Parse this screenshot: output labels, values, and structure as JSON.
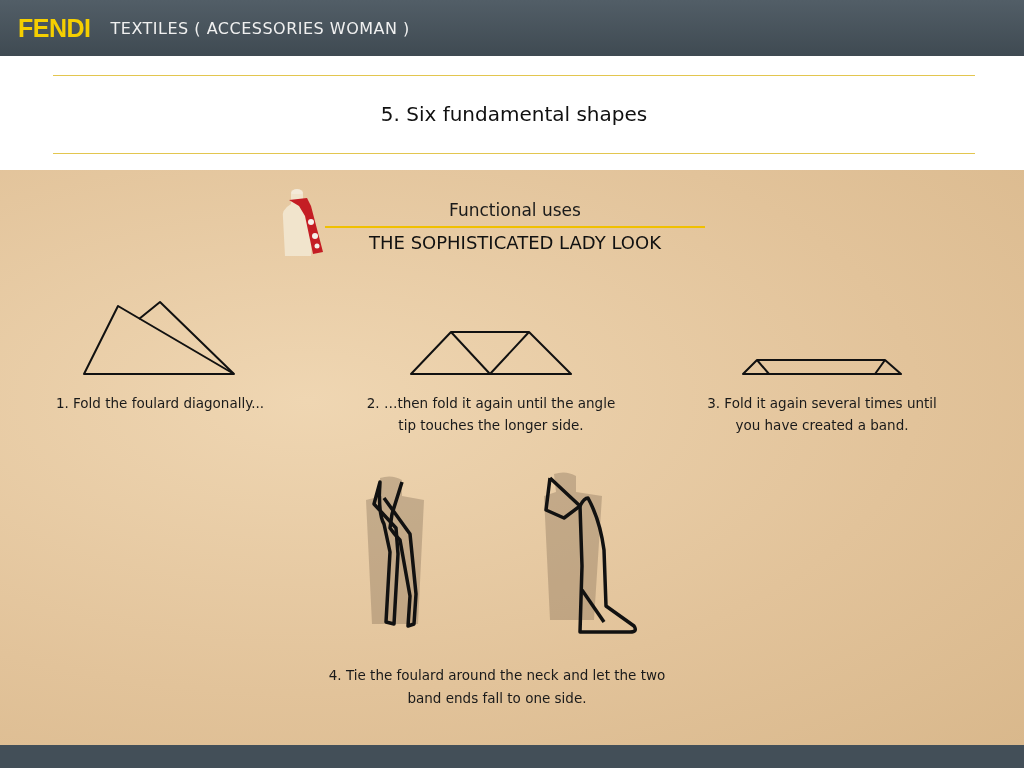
{
  "header": {
    "brand": "FENDI",
    "section": "TEXTILES ( ACCESSORIES WOMAN )"
  },
  "page_title": "5. Six fundamental shapes",
  "lesson": {
    "subtitle": "Functional uses",
    "title": "THE SOPHISTICATED LADY LOOK"
  },
  "steps": [
    {
      "kind": "diagonal",
      "text": "1. Fold the foulard  diagonally..."
    },
    {
      "kind": "fold",
      "text": "2. …then fold it again until the angle tip touches the longer side."
    },
    {
      "kind": "band",
      "text": "3. Fold it again several times until you have created a band."
    }
  ],
  "final_step": {
    "text": "4. Tie the foulard around the neck and let the two band ends fall to one side."
  }
}
